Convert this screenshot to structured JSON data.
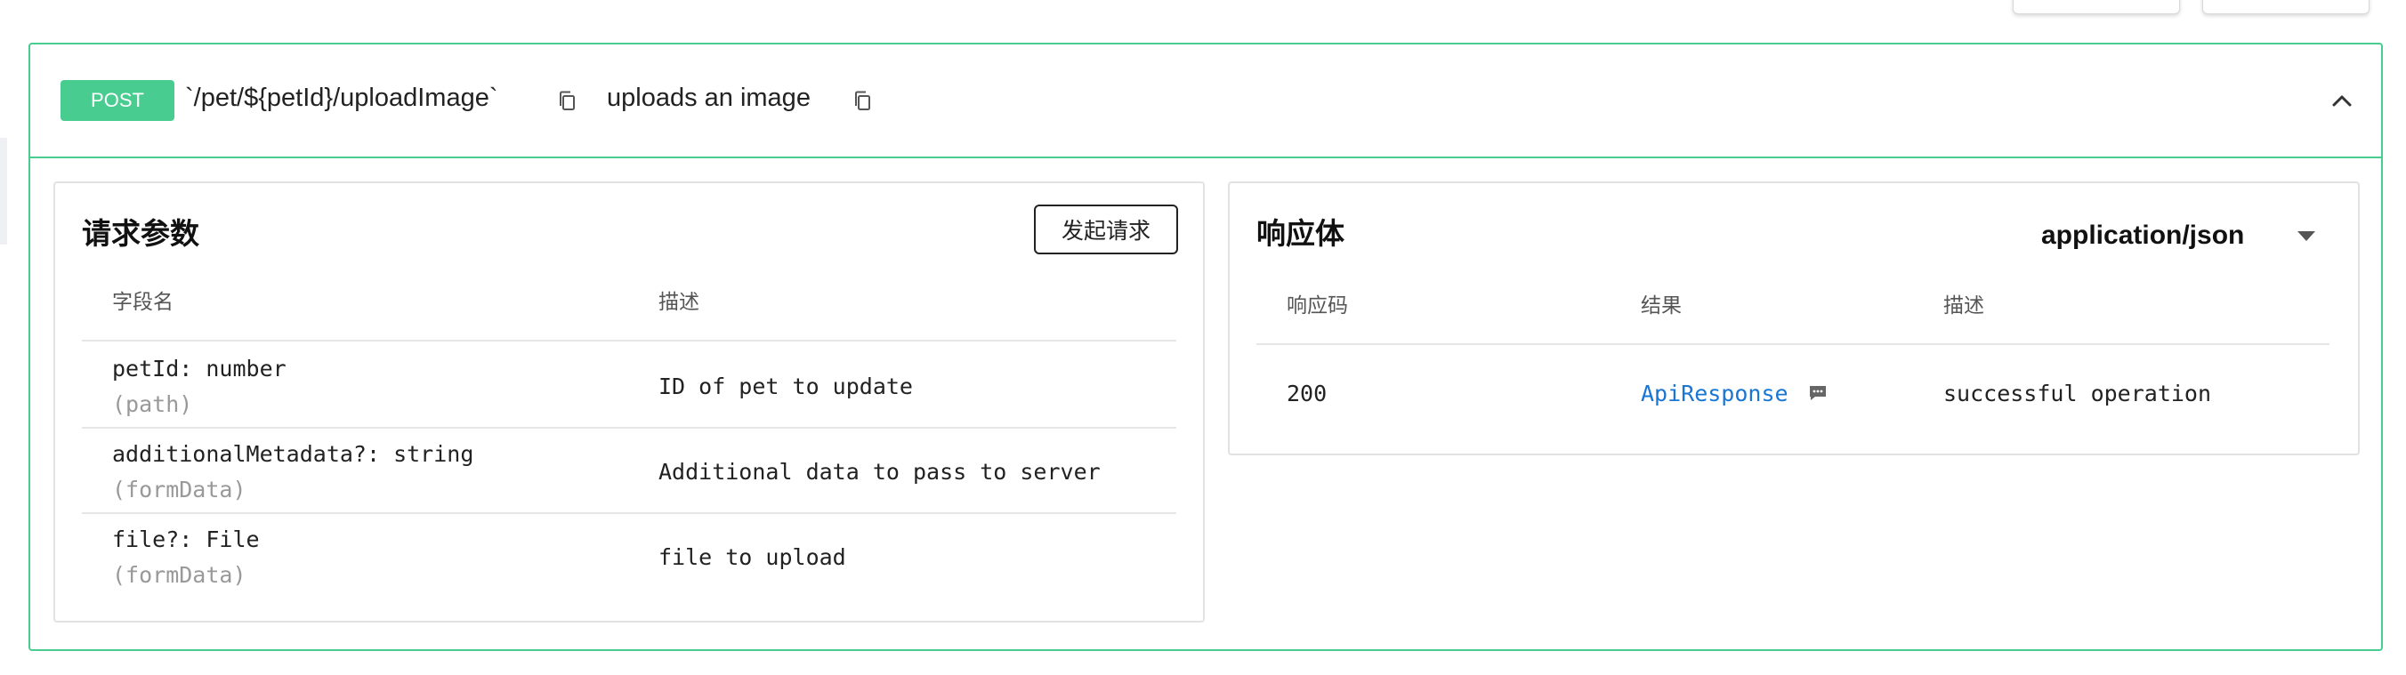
{
  "endpoint": {
    "method": "POST",
    "path": "`/pet/${petId}/uploadImage`",
    "summary": "uploads an image",
    "colors": {
      "post": "#49cc90",
      "link": "#1976d2"
    }
  },
  "request": {
    "title": "请求参数",
    "send_label": "发起请求",
    "headers": {
      "field": "字段名",
      "desc": "描述"
    },
    "params": [
      {
        "name": "petId: number",
        "in": "(path)",
        "desc": "ID of pet to update"
      },
      {
        "name": "additionalMetadata?: string",
        "in": "(formData)",
        "desc": "Additional data to pass to server"
      },
      {
        "name": "file?: File",
        "in": "(formData)",
        "desc": "file to upload"
      }
    ]
  },
  "response": {
    "title": "响应体",
    "content_type": "application/json",
    "headers": {
      "code": "响应码",
      "result": "结果",
      "desc": "描述"
    },
    "rows": [
      {
        "code": "200",
        "result": "ApiResponse",
        "desc": "successful operation"
      }
    ]
  },
  "icons": {
    "copy": "copy-icon",
    "collapse": "chevron-up-icon",
    "dropdown": "caret-down-icon",
    "message": "message-icon"
  }
}
